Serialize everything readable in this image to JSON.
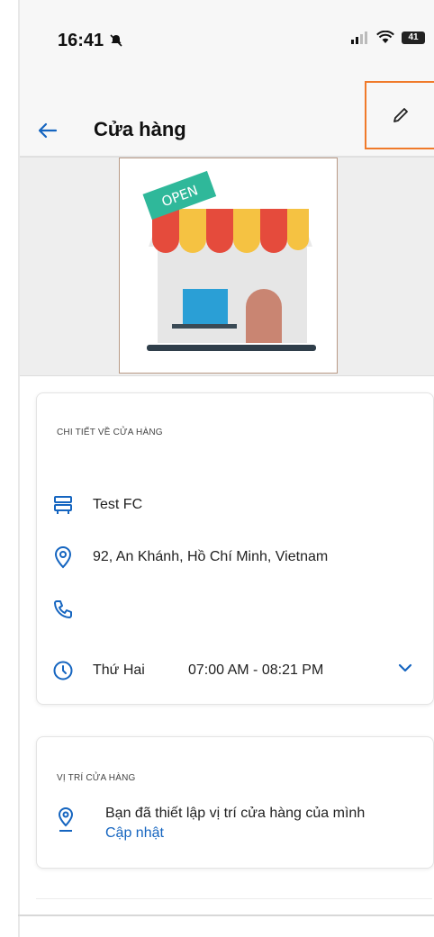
{
  "status_bar": {
    "time": "16:41",
    "battery": "41"
  },
  "header": {
    "title": "Cửa hàng"
  },
  "banner": {
    "open_sign": "OPEN"
  },
  "details": {
    "heading": "CHI TIẾT VỀ CỬA HÀNG",
    "store_name": "Test FC",
    "address": "92, An Khánh, Hồ Chí Minh, Vietnam",
    "phone": "",
    "day": "Thứ Hai",
    "hours": "07:00  AM - 08:21  PM"
  },
  "location": {
    "heading": "VỊ TRÍ CỬA HÀNG",
    "message": "Bạn đã thiết lập vị trí cửa hàng của mình",
    "update_link": "Cập nhật"
  },
  "colors": {
    "accent": "#1565c0",
    "highlight": "#f07a2a"
  }
}
